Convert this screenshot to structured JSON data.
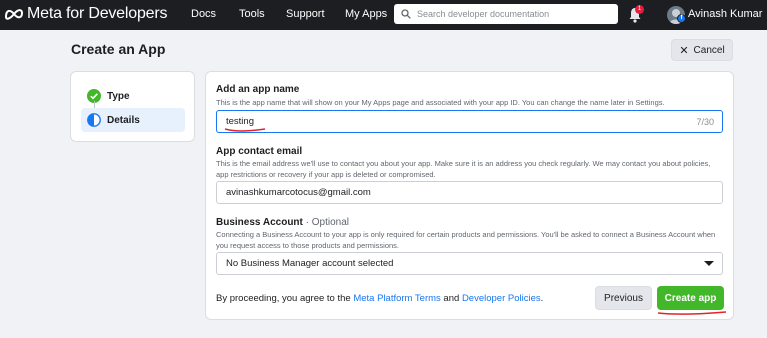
{
  "topnav": {
    "brand": "Meta for Developers",
    "links": [
      "Docs",
      "Tools",
      "Support",
      "My Apps"
    ],
    "search_placeholder": "Search developer documentation",
    "notification_count": "1",
    "user_name": "Avinash Kumar"
  },
  "header": {
    "title": "Create an App",
    "cancel_label": "Cancel"
  },
  "steps": [
    {
      "label": "Type",
      "state": "complete"
    },
    {
      "label": "Details",
      "state": "active"
    }
  ],
  "form": {
    "app_name": {
      "label": "Add an app name",
      "help": "This is the app name that will show on your My Apps page and associated with your app ID. You can change the name later in Settings.",
      "value": "testing",
      "counter": "7/30"
    },
    "contact_email": {
      "label": "App contact email",
      "help": "This is the email address we'll use to contact you about your app. Make sure it is an address you check regularly. We may contact you about policies, app restrictions or recovery if your app is deleted or compromised.",
      "value": "avinashkumarcotocus@gmail.com"
    },
    "business_account": {
      "label": "Business Account",
      "optional": "· Optional",
      "help": "Connecting a Business Account to your app is only required for certain products and permissions. You'll be asked to connect a Business Account when you request access to those products and permissions.",
      "selected": "No Business Manager account selected"
    },
    "terms": {
      "prefix": "By proceeding, you agree to the ",
      "link1": "Meta Platform Terms",
      "middle": " and ",
      "link2": "Developer Policies",
      "suffix": "."
    },
    "previous_label": "Previous",
    "create_label": "Create app"
  },
  "colors": {
    "nav_bg": "#1c1e21",
    "accent_blue": "#1877f2",
    "create_green": "#42b72a",
    "annotation_red": "#e0242a"
  }
}
